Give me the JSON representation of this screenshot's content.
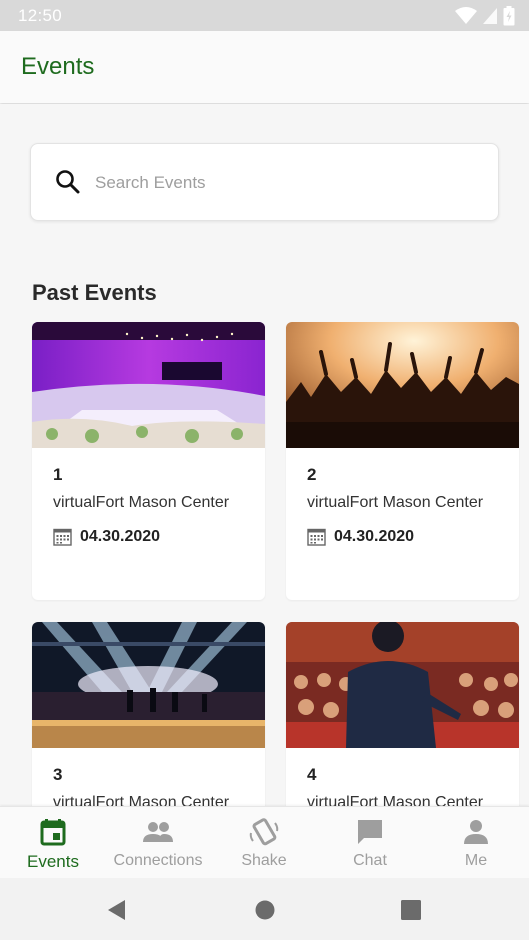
{
  "status_bar": {
    "time": "12:50"
  },
  "app_bar": {
    "title": "Events"
  },
  "search": {
    "placeholder": "Search Events"
  },
  "section": {
    "title": "Past Events"
  },
  "events": [
    {
      "number": "1",
      "location": "virtualFort Mason Center",
      "date": "04.30.2020"
    },
    {
      "number": "2",
      "location": "virtualFort Mason Center",
      "date": "04.30.2020"
    },
    {
      "number": "3",
      "location": "virtualFort Mason Center"
    },
    {
      "number": "4",
      "location": "virtualFort Mason Center"
    }
  ],
  "bottom_nav": {
    "items": [
      {
        "label": "Events",
        "icon": "calendar-icon",
        "active": true
      },
      {
        "label": "Connections",
        "icon": "people-icon"
      },
      {
        "label": "Shake",
        "icon": "shake-phone-icon"
      },
      {
        "label": "Chat",
        "icon": "chat-bubble-icon"
      },
      {
        "label": "Me",
        "icon": "person-icon"
      }
    ]
  },
  "colors": {
    "accent": "#1e6b1e",
    "inactive": "#9e9e9e"
  }
}
